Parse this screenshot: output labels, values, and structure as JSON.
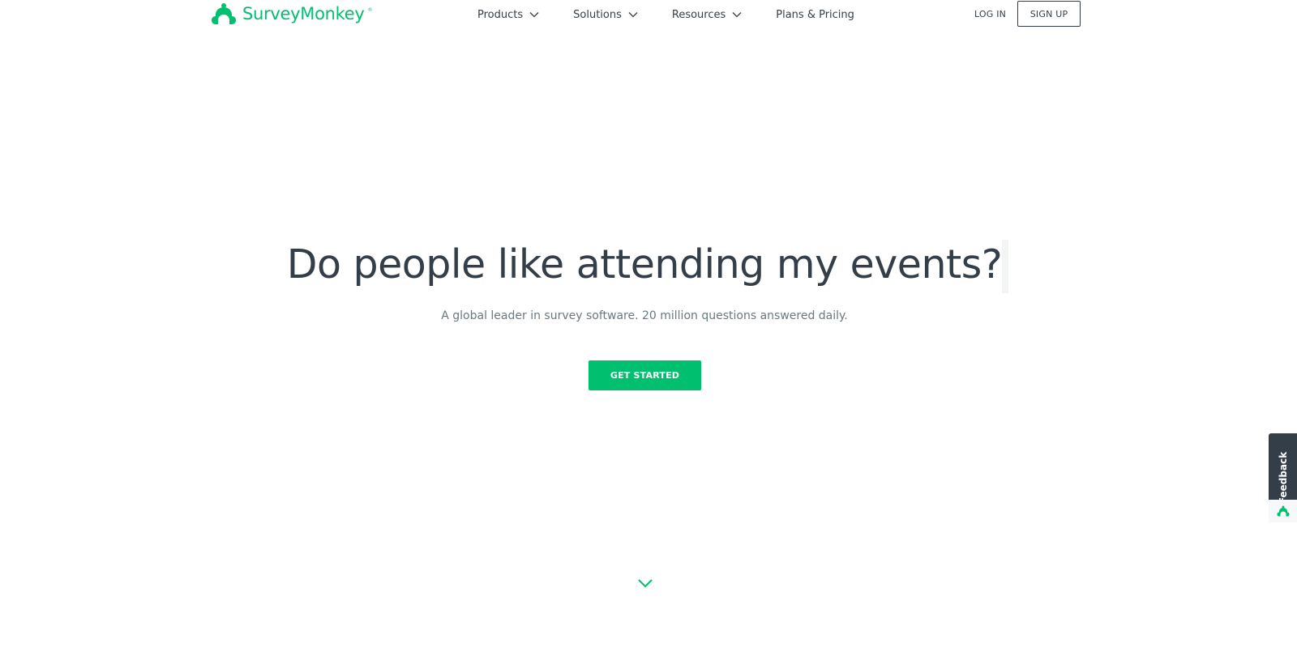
{
  "brand": {
    "name": "SurveyMonkey",
    "registered_mark": "®",
    "logo_icon": "surveymonkey-logo-icon",
    "accent_color": "#00bf6f",
    "text_color": "#333e48"
  },
  "nav": {
    "items": [
      {
        "label": "Products",
        "icon": "chevron-down-icon"
      },
      {
        "label": "Solutions",
        "icon": "chevron-down-icon"
      },
      {
        "label": "Resources",
        "icon": "chevron-down-icon"
      },
      {
        "label": "Plans & Pricing"
      }
    ],
    "login_label": "LOG IN",
    "signup_label": "SIGN UP"
  },
  "hero": {
    "title": "Do people like attending my events?",
    "subtitle": "A global leader in survey software. 20 million questions answered daily.",
    "cta_label": "GET STARTED",
    "scroll_icon": "chevron-down-icon"
  },
  "feedback": {
    "label": "Feedback",
    "icon": "surveymonkey-logo-icon"
  }
}
